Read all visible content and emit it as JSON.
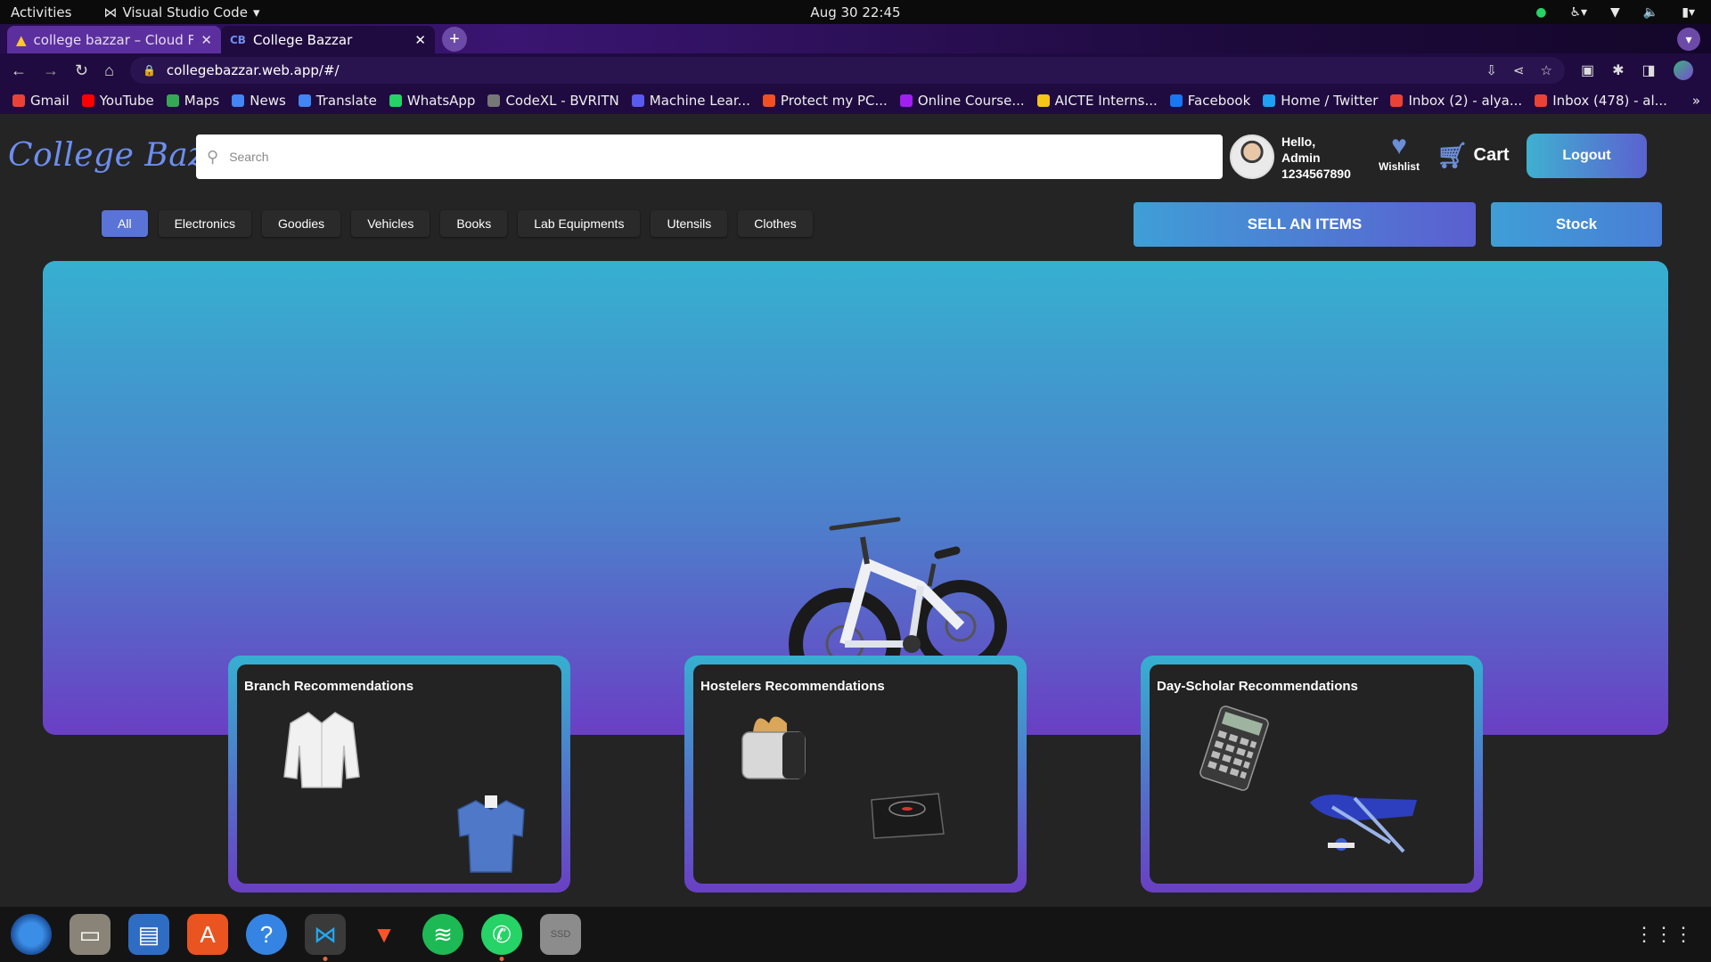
{
  "system": {
    "activities": "Activities",
    "app_menu": "Visual Studio Code",
    "clock": "Aug 30  22:45"
  },
  "browser": {
    "tabs": [
      {
        "title": "college bazzar – Cloud Fir",
        "active": false
      },
      {
        "title": "College Bazzar",
        "active": true
      }
    ],
    "url": "collegebazzar.web.app/#/",
    "bookmarks": [
      {
        "label": "Gmail",
        "color": "#ea4335"
      },
      {
        "label": "YouTube",
        "color": "#ff0000"
      },
      {
        "label": "Maps",
        "color": "#34a853"
      },
      {
        "label": "News",
        "color": "#4285f4"
      },
      {
        "label": "Translate",
        "color": "#4285f4"
      },
      {
        "label": "WhatsApp",
        "color": "#25d366"
      },
      {
        "label": "CodeXL - BVRITN",
        "color": "#777777"
      },
      {
        "label": "Machine Lear...",
        "color": "#5a5af0"
      },
      {
        "label": "Protect my PC...",
        "color": "#f25022"
      },
      {
        "label": "Online Course...",
        "color": "#a020f0"
      },
      {
        "label": "AICTE Interns...",
        "color": "#f5c518"
      },
      {
        "label": "Facebook",
        "color": "#1877f2"
      },
      {
        "label": "Home / Twitter",
        "color": "#1da1f2"
      },
      {
        "label": "Inbox (2) - alya...",
        "color": "#ea4335"
      },
      {
        "label": "Inbox (478) - al...",
        "color": "#ea4335"
      }
    ]
  },
  "site": {
    "logo": "College Bazzar",
    "search_placeholder": "Search",
    "greeting": {
      "line1": "Hello,",
      "line2": "Admin",
      "line3": "1234567890"
    },
    "wishlist_label": "Wishlist",
    "cart_label": "Cart",
    "logout_label": "Logout",
    "categories": [
      "All",
      "Electronics",
      "Goodies",
      "Vehicles",
      "Books",
      "Lab Equipments",
      "Utensils",
      "Clothes"
    ],
    "active_category": "All",
    "sell_label": "SELL AN ITEMS",
    "stock_label": "Stock",
    "recommendations": [
      {
        "title": "Branch Recommendations"
      },
      {
        "title": "Hostelers Recommendations"
      },
      {
        "title": "Day-Scholar Recommendations"
      }
    ]
  },
  "colors": {
    "accent": "#5a73d6",
    "banner_top": "#36b0d0",
    "banner_bottom": "#6a3fc4"
  }
}
